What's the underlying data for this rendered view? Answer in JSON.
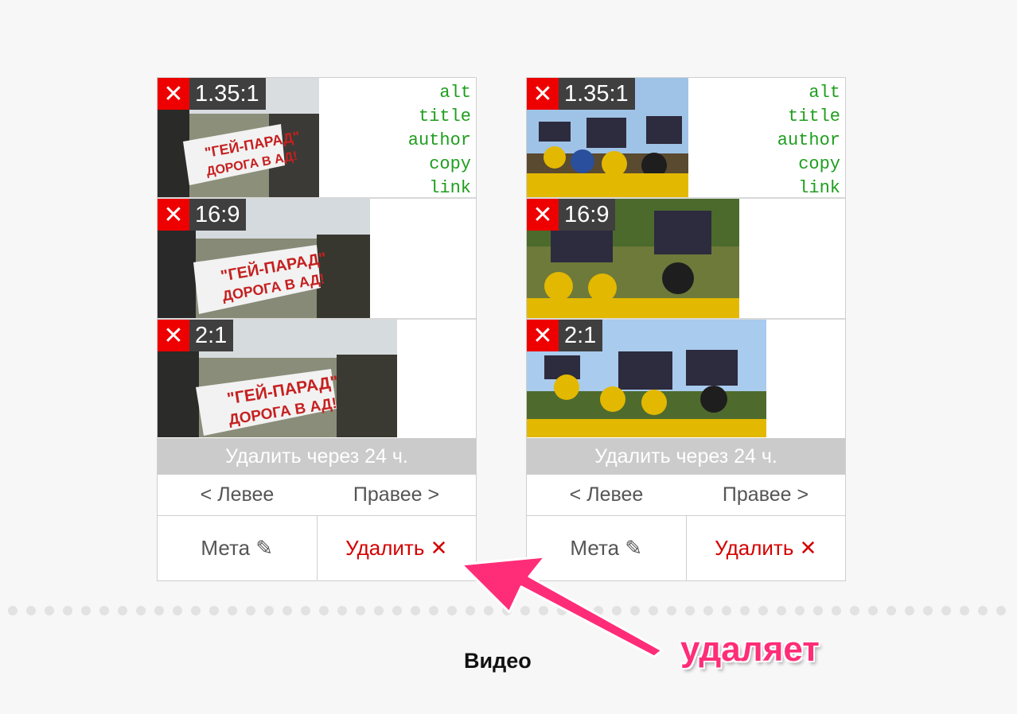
{
  "cards": [
    {
      "crops": [
        {
          "ratio": "1.35:1",
          "remove_icon": "close-icon"
        },
        {
          "ratio": "16:9",
          "remove_icon": "close-icon"
        },
        {
          "ratio": "2:1",
          "remove_icon": "close-icon"
        }
      ],
      "meta_links": [
        "alt",
        "title",
        "author",
        "copy",
        "link"
      ],
      "expire_text": "Удалить через 24 ч.",
      "move_left": "< Левее",
      "move_right": "Правее >",
      "meta_button": "Мета ✎",
      "delete_button": "Удалить ✕"
    },
    {
      "crops": [
        {
          "ratio": "1.35:1",
          "remove_icon": "close-icon"
        },
        {
          "ratio": "16:9",
          "remove_icon": "close-icon"
        },
        {
          "ratio": "2:1",
          "remove_icon": "close-icon"
        }
      ],
      "meta_links": [
        "alt",
        "title",
        "author",
        "copy",
        "link"
      ],
      "expire_text": "Удалить через 24 ч.",
      "move_left": "< Левее",
      "move_right": "Правее >",
      "meta_button": "Мета ✎",
      "delete_button": "Удалить ✕"
    }
  ],
  "section_label": "Видео",
  "annotation": "удаляет",
  "colors": {
    "accent_delete": "#d40000",
    "link_green": "#1e9e1e",
    "annotation_pink": "#ff2d78"
  }
}
